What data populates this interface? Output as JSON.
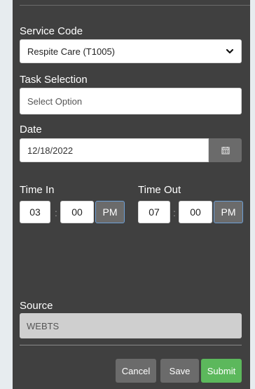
{
  "form": {
    "service_code": {
      "label": "Service Code",
      "value": "Respite Care (T1005)"
    },
    "task_selection": {
      "label": "Task Selection",
      "placeholder": "Select Option"
    },
    "date": {
      "label": "Date",
      "value": "12/18/2022"
    },
    "time_in": {
      "label": "Time In",
      "hour": "03",
      "separator": ":",
      "minute": "00",
      "period": "PM"
    },
    "time_out": {
      "label": "Time Out",
      "hour": "07",
      "separator": ":",
      "minute": "00",
      "period": "PM"
    },
    "source": {
      "label": "Source",
      "value": "WEBTS"
    }
  },
  "actions": {
    "cancel_label": "Cancel",
    "save_label": "Save",
    "submit_label": "Submit"
  },
  "icons": {
    "select_chevron": "chevron-down-icon",
    "date_picker": "calendar-icon"
  },
  "colors": {
    "panel_background": "#404040",
    "submit_button": "#5cb85c",
    "secondary_button": "#6b6b6b",
    "period_toggle_border": "#6d9fd6"
  }
}
